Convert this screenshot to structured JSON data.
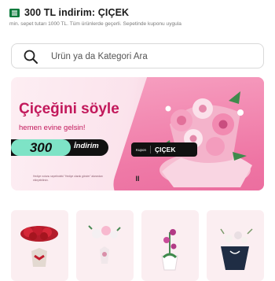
{
  "coupon": {
    "title": "300 TL indirim: ÇIÇEK",
    "description": "min. sepet tutarı 1000 TL. Tüm ürünlerde geçerli. Sepetinde kuponu uygula",
    "accent_color": "#0a7a3c"
  },
  "search": {
    "placeholder": "Ürün ya da Kategori Ara",
    "icon": "search-icon"
  },
  "banner": {
    "headline": "Çiçeğini söyle",
    "subline": "hemen evine gelsin!",
    "amount": "300",
    "amount_word": "İndirim",
    "coupon_label": "Kupon",
    "coupon_code": "ÇIÇEK",
    "fine_print": "Hediye notunu sepetindeki \"Hediye olarak gönder\" alanından ekleyebilirsin.",
    "brand_color": "#c2185b",
    "pause_icon": "pause-icon",
    "pause_glyph": "II"
  },
  "categories": {
    "items": [
      {
        "icon": "red-roses-bouquet-icon"
      },
      {
        "icon": "white-flower-bouquet-icon"
      },
      {
        "icon": "orchid-pot-icon"
      },
      {
        "icon": "flower-box-icon"
      }
    ]
  }
}
